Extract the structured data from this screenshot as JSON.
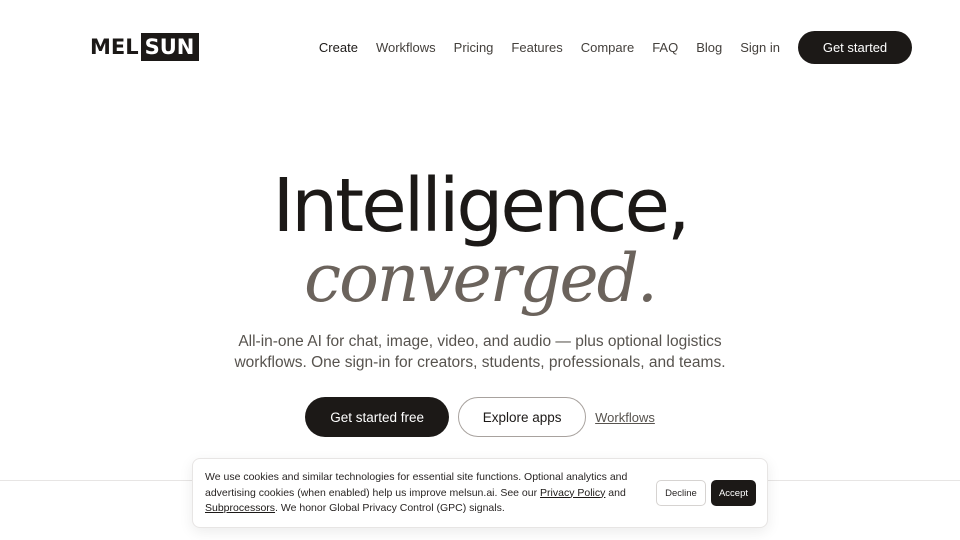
{
  "brand": {
    "logo_left": "MEL",
    "logo_right": "SUN"
  },
  "nav": {
    "items": [
      {
        "label": "Create"
      },
      {
        "label": "Workflows"
      },
      {
        "label": "Pricing"
      },
      {
        "label": "Features"
      },
      {
        "label": "Compare"
      },
      {
        "label": "FAQ"
      },
      {
        "label": "Blog"
      },
      {
        "label": "Sign in"
      }
    ],
    "cta_label": "Get started"
  },
  "hero": {
    "title": "Intelligence,",
    "subtitle": "converged.",
    "description_line1": "All-in-one AI for chat, image, video, and audio — plus optional logistics",
    "description_line2": "workflows. One sign-in for creators, students, professionals, and teams.",
    "primary_label": "Get started free",
    "secondary_label": "Explore apps",
    "link_label": "Workflows"
  },
  "cookie": {
    "text_part1": "We use cookies and similar technologies for essential site functions. Optional analytics and advertising cookies (when enabled) help us improve melsun.ai. See our ",
    "privacy_link": "Privacy Policy",
    "text_part2": " and ",
    "subprocessors_link": "Subprocessors",
    "text_part3": ". We honor Global Privacy Control (GPC) signals.",
    "decline_label": "Decline",
    "accept_label": "Accept"
  },
  "colors": {
    "ink": "#1c1917",
    "muted": "#6b635c",
    "background": "#ffffff"
  }
}
